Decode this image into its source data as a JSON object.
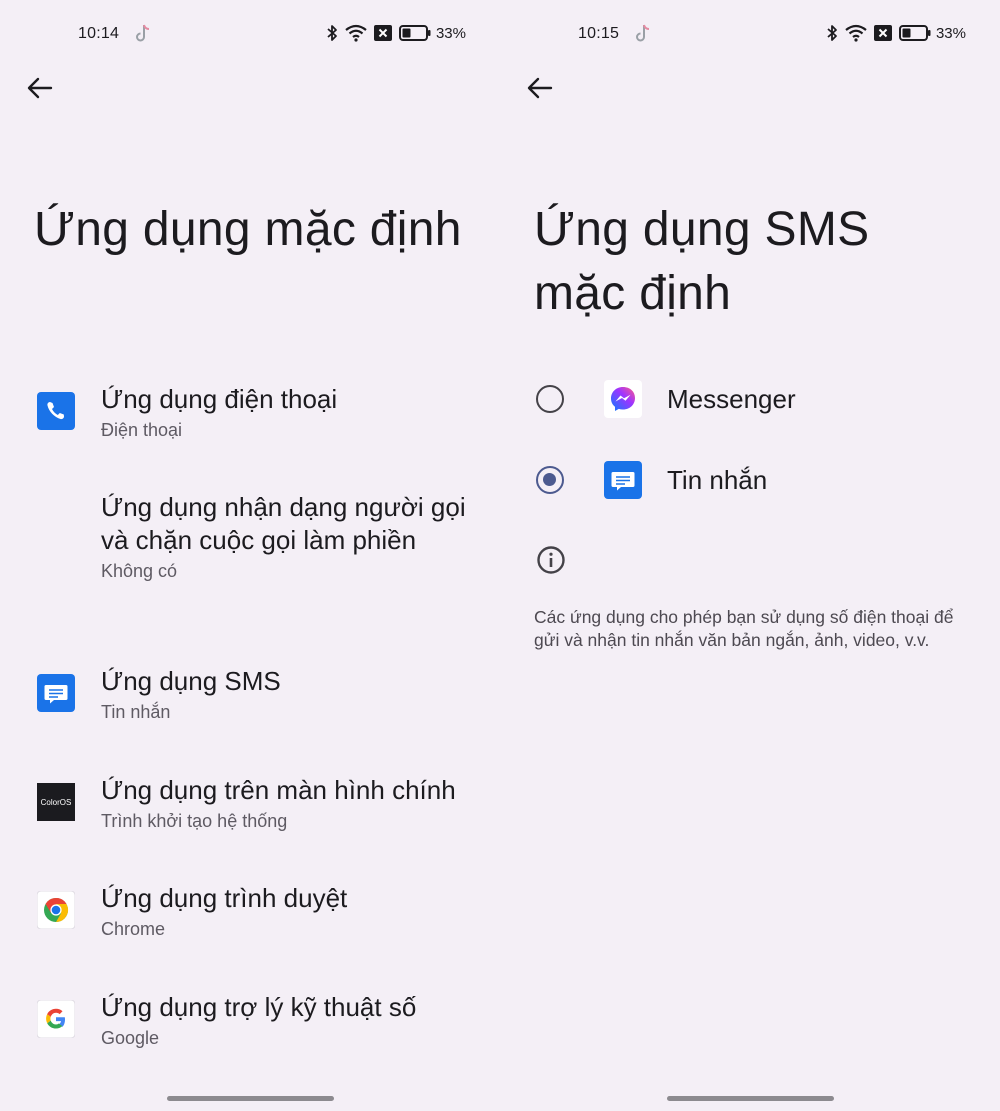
{
  "left": {
    "status": {
      "time": "10:14",
      "battery": "33%"
    },
    "title": "Ứng dụng mặc định",
    "items": [
      {
        "title": "Ứng dụng điện thoại",
        "subtitle": "Điện thoại",
        "icon": "phone-icon"
      },
      {
        "title": "Ứng dụng nhận dạng người gọi và chặn cuộc gọi làm phiền",
        "subtitle": "Không có",
        "icon": ""
      },
      {
        "title": "Ứng dụng SMS",
        "subtitle": "Tin nhắn",
        "icon": "messages-icon"
      },
      {
        "title": "Ứng dụng trên màn hình chính",
        "subtitle": "Trình khởi tạo hệ thống",
        "icon": "coloros-icon",
        "icon_text": "ColorOS"
      },
      {
        "title": "Ứng dụng trình duyệt",
        "subtitle": "Chrome",
        "icon": "chrome-icon"
      },
      {
        "title": "Ứng dụng trợ lý kỹ thuật số",
        "subtitle": "Google",
        "icon": "google-icon"
      }
    ]
  },
  "right": {
    "status": {
      "time": "10:15",
      "battery": "33%"
    },
    "title": "Ứng dụng SMS mặc định",
    "options": [
      {
        "label": "Messenger",
        "selected": false,
        "icon": "messenger-icon"
      },
      {
        "label": "Tin nhắn",
        "selected": true,
        "icon": "messages-icon"
      }
    ],
    "info_text": "Các ứng dụng cho phép bạn sử dụng số điện thoại để gửi và nhận tin nhắn văn bản ngắn, ảnh, video, v.v."
  },
  "colors": {
    "background": "#f4eff6",
    "accent_radio": "#4c5a8f",
    "app_blue": "#1a73e8"
  }
}
